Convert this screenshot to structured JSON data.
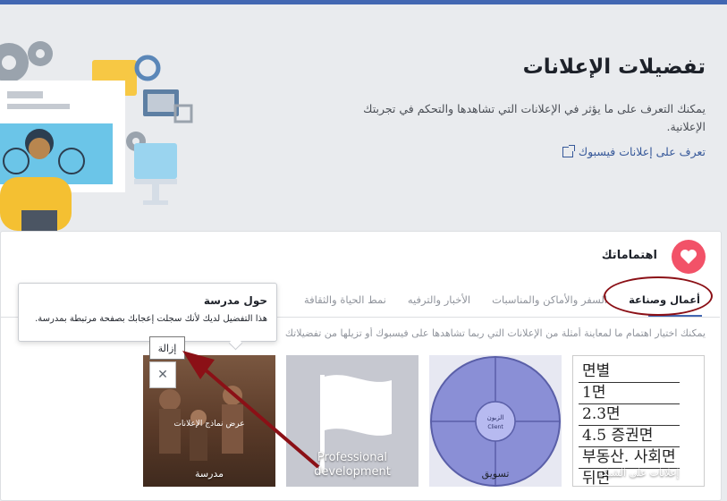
{
  "header": {
    "title": "تفضيلات الإعلانات",
    "description": "يمكنك التعرف على ما يؤثر في الإعلانات التي تشاهدها والتحكم في تجربتك الإعلانية.",
    "link_label": "تعرف على إعلانات فيسبوك"
  },
  "interests": {
    "title": "اهتماماتك",
    "tabs": [
      {
        "label": "أعمال وصناعة"
      },
      {
        "label": "السفر والأماكن والمناسبات"
      },
      {
        "label": "الأخبار والترفيه"
      },
      {
        "label": "نمط الحياة والثقافة"
      }
    ],
    "intro": "يمكنك اختيار اهتمام ما لمعاينة أمثلة من الإعلانات التي ربما تشاهدها على فيسبوك أو تزيلها من تفضيلاتك"
  },
  "tooltip": {
    "title": "حول مدرسة",
    "description": "هذا التفضيل لديك لأنك سجلت إعجابك بصفحة مرتبطة بمدرسة."
  },
  "remove_label": "إزالة",
  "close_glyph": "✕",
  "tiles": [
    {
      "label": "مدرسة",
      "hover_text": "عرض نماذج الإعلانات"
    },
    {
      "label": "Professional development"
    },
    {
      "label": "تسويق",
      "diagram_center": "الزبون",
      "diagram_center_en": "Client"
    },
    {
      "label": "إعلانات على الشبكة",
      "korean_lines": [
        "면별",
        "1면",
        "2.3면",
        "4.5 증권면",
        "부동산. 사회면",
        "뒤면"
      ]
    }
  ],
  "colors": {
    "brand": "#4267b2",
    "heart": "#f25268",
    "annotation_red": "#8b1016",
    "link": "#365899"
  }
}
